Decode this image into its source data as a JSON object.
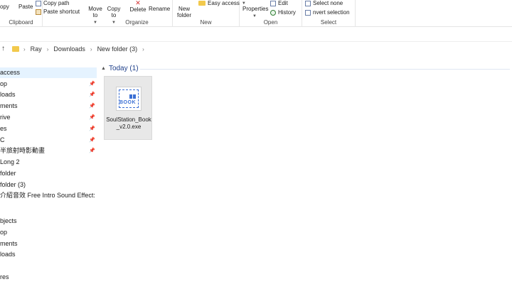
{
  "ribbon": {
    "clipboard": {
      "copy": "opy",
      "paste": "Paste",
      "copy_path": "Copy path",
      "paste_shortcut": "Paste shortcut",
      "label": "Clipboard"
    },
    "organize": {
      "move_to": "Move to",
      "copy_to": "Copy to",
      "delete": "Delete",
      "rename": "Rename",
      "label": "Organize"
    },
    "new": {
      "new_folder": "New folder",
      "easy_access": "Easy access",
      "label": "New"
    },
    "open": {
      "properties": "Properties",
      "edit": "Edit",
      "history": "History",
      "label": "Open"
    },
    "select": {
      "select_none": "Select none",
      "invert_selection": "nvert selection",
      "label": "Select"
    }
  },
  "address": {
    "crumbs": [
      "Ray",
      "Downloads",
      "New folder (3)"
    ]
  },
  "nav": {
    "items": [
      {
        "label": "access",
        "pinned": false,
        "selected": true
      },
      {
        "label": "op",
        "pinned": true
      },
      {
        "label": "loads",
        "pinned": true
      },
      {
        "label": "ments",
        "pinned": true
      },
      {
        "label": "rive",
        "pinned": true
      },
      {
        "label": "es",
        "pinned": true
      },
      {
        "label": "C",
        "pinned": true
      },
      {
        "label": "半旅射時影動畫",
        "pinned": true
      },
      {
        "label": "Long 2",
        "pinned": false
      },
      {
        "label": "folder",
        "pinned": false
      },
      {
        "label": "folder (3)",
        "pinned": false
      },
      {
        "label": "介紹音效 Free Intro Sound Effect:",
        "pinned": false
      },
      {
        "label": "",
        "pinned": false
      },
      {
        "label": "bjects",
        "pinned": false
      },
      {
        "label": "op",
        "pinned": false
      },
      {
        "label": "ments",
        "pinned": false
      },
      {
        "label": "loads",
        "pinned": false
      },
      {
        "label": "",
        "pinned": false
      },
      {
        "label": "res",
        "pinned": false
      }
    ]
  },
  "content": {
    "group_title": "Today (1)",
    "file": {
      "name": "SoulStation_Book_v2.0.exe",
      "thumb_text": "BOOK"
    }
  },
  "colors": {
    "accent": "#3b6fd4",
    "group_title": "#1e3f8a",
    "selected_nav": "#e5f3ff"
  }
}
